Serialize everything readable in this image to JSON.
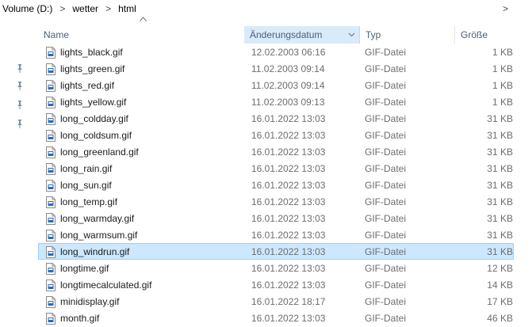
{
  "breadcrumb": {
    "items": [
      "Volume (D:)",
      "wetter",
      "html"
    ],
    "separator": ">"
  },
  "columns": {
    "name": "Name",
    "date": "Änderungsdatum",
    "type": "Typ",
    "size": "Größe"
  },
  "colors": {
    "selected_bg": "#cce8ff",
    "selected_border": "#99d1ff",
    "header_sorted_bg": "#d9ebf9",
    "header_text": "#4c607a"
  },
  "files": [
    {
      "name": "lights_black.gif",
      "date": "12.02.2003 06:16",
      "type": "GIF-Datei",
      "size": "1 KB"
    },
    {
      "name": "lights_green.gif",
      "date": "11.02.2003 09:14",
      "type": "GIF-Datei",
      "size": "1 KB"
    },
    {
      "name": "lights_red.gif",
      "date": "11.02.2003 09:14",
      "type": "GIF-Datei",
      "size": "1 KB"
    },
    {
      "name": "lights_yellow.gif",
      "date": "11.02.2003 09:13",
      "type": "GIF-Datei",
      "size": "1 KB"
    },
    {
      "name": "long_coldday.gif",
      "date": "16.01.2022 13:03",
      "type": "GIF-Datei",
      "size": "31 KB"
    },
    {
      "name": "long_coldsum.gif",
      "date": "16.01.2022 13:03",
      "type": "GIF-Datei",
      "size": "31 KB"
    },
    {
      "name": "long_greenland.gif",
      "date": "16.01.2022 13:03",
      "type": "GIF-Datei",
      "size": "31 KB"
    },
    {
      "name": "long_rain.gif",
      "date": "16.01.2022 13:03",
      "type": "GIF-Datei",
      "size": "31 KB"
    },
    {
      "name": "long_sun.gif",
      "date": "16.01.2022 13:03",
      "type": "GIF-Datei",
      "size": "31 KB"
    },
    {
      "name": "long_temp.gif",
      "date": "16.01.2022 13:03",
      "type": "GIF-Datei",
      "size": "31 KB"
    },
    {
      "name": "long_warmday.gif",
      "date": "16.01.2022 13:03",
      "type": "GIF-Datei",
      "size": "31 KB"
    },
    {
      "name": "long_warmsum.gif",
      "date": "16.01.2022 13:03",
      "type": "GIF-Datei",
      "size": "31 KB"
    },
    {
      "name": "long_windrun.gif",
      "date": "16.01.2022 13:03",
      "type": "GIF-Datei",
      "size": "31 KB",
      "selected": true
    },
    {
      "name": "longtime.gif",
      "date": "16.01.2022 13:03",
      "type": "GIF-Datei",
      "size": "12 KB"
    },
    {
      "name": "longtimecalculated.gif",
      "date": "16.01.2022 13:03",
      "type": "GIF-Datei",
      "size": "14 KB"
    },
    {
      "name": "minidisplay.gif",
      "date": "16.01.2022 18:17",
      "type": "GIF-Datei",
      "size": "17 KB"
    },
    {
      "name": "month.gif",
      "date": "16.01.2022 13:03",
      "type": "GIF-Datei",
      "size": "46 KB"
    }
  ],
  "icons": {
    "file": "gif-file-icon",
    "pin": "pin-icon",
    "sort": "sort-up-icon",
    "dropdown": "chevron-down-icon"
  }
}
